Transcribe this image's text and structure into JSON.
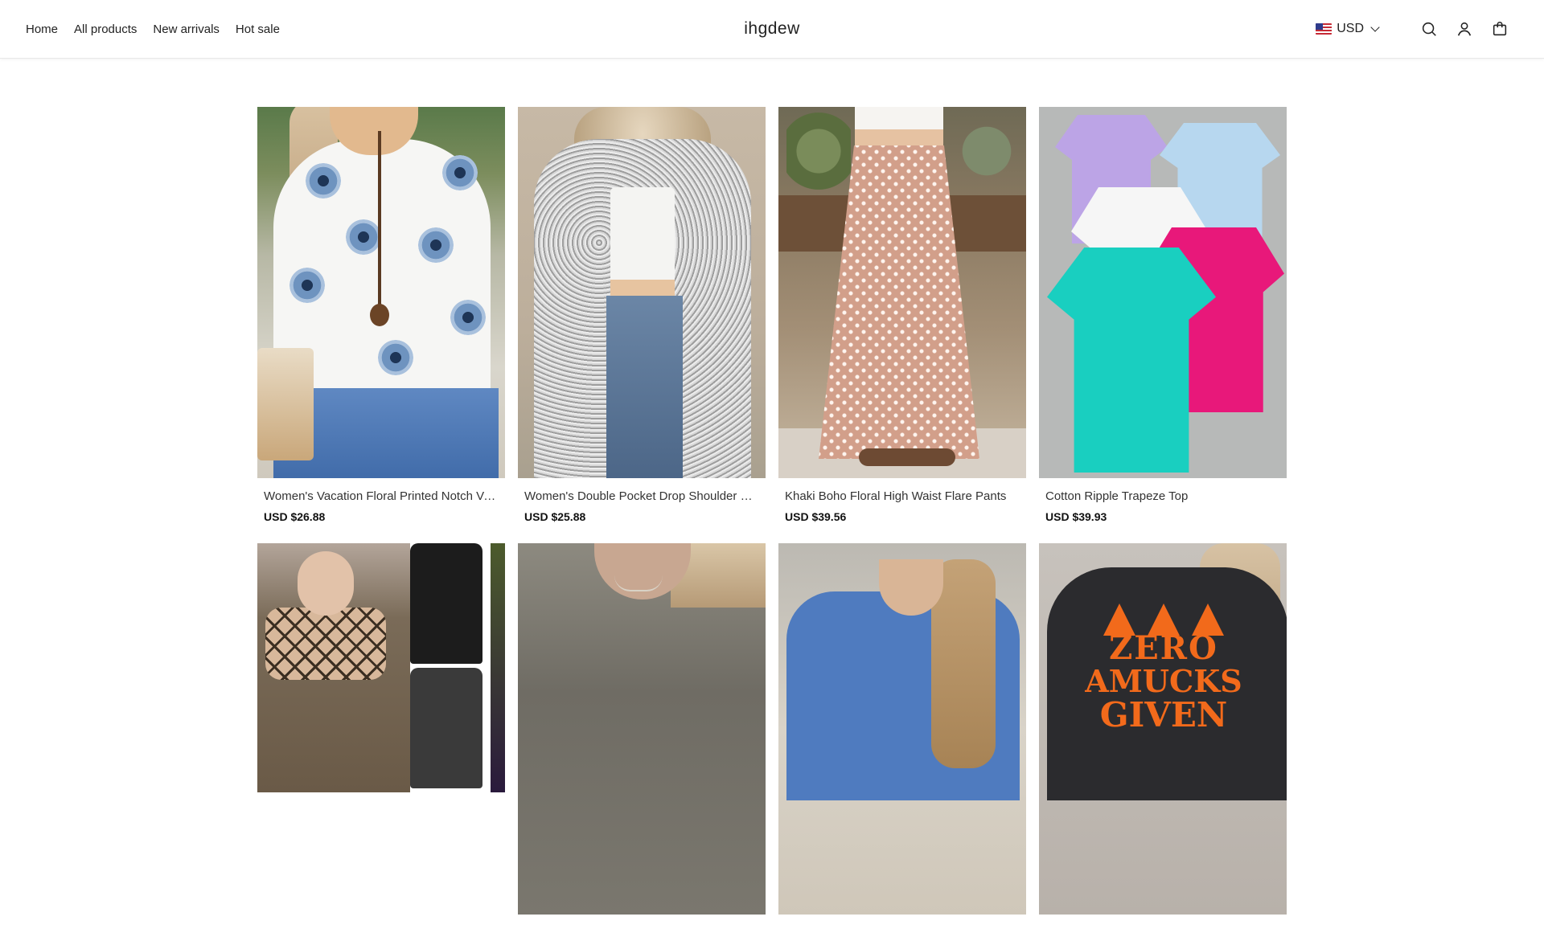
{
  "header": {
    "nav": [
      {
        "label": "Home"
      },
      {
        "label": "All products"
      },
      {
        "label": "New arrivals"
      },
      {
        "label": "Hot sale"
      }
    ],
    "logo": "ihgdew",
    "currency": {
      "label": "USD",
      "flag_icon": "us-flag-icon"
    },
    "icons": [
      "search-icon",
      "user-icon",
      "cart-icon"
    ]
  },
  "products": [
    {
      "title": "Women's Vacation Floral Printed Notch V-Neck Half Sleeve Blouse",
      "price": "USD $26.88"
    },
    {
      "title": "Women's Double Pocket Drop Shoulder Fuzzy Cardigan",
      "price": "USD $25.88"
    },
    {
      "title": "Khaki Boho Floral High Waist Flare Pants",
      "price": "USD $39.56"
    },
    {
      "title": "Cotton Ripple Trapeze Top",
      "price": "USD $39.93"
    },
    {
      "title": "",
      "price": ""
    },
    {
      "title": "",
      "price": ""
    },
    {
      "title": "",
      "price": ""
    },
    {
      "title": "",
      "price": ""
    }
  ],
  "graphics": {
    "sweatshirt_print": [
      "ZERO",
      "AMUCKS",
      "GIVEN"
    ]
  },
  "colors": {
    "header_bg": "#ffffff",
    "text": "#222222",
    "halloween_orange": "#f26a1b"
  }
}
